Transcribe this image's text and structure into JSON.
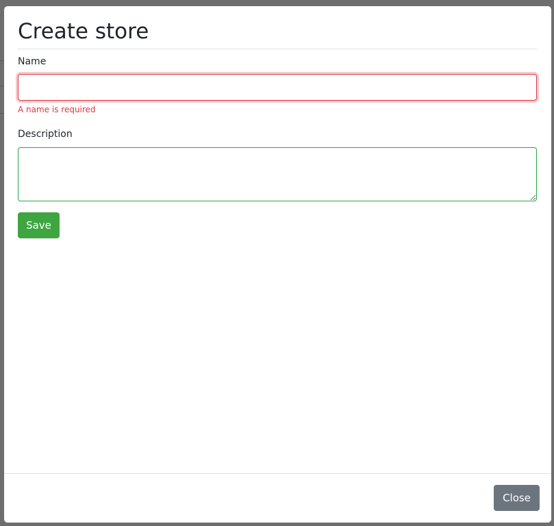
{
  "modal": {
    "title": "Create store"
  },
  "form": {
    "name_label": "Name",
    "name_value": "",
    "name_error": "A name is required",
    "description_label": "Description",
    "description_value": "",
    "save_label": "Save"
  },
  "footer": {
    "close_label": "Close"
  },
  "colors": {
    "error": "#dc3545",
    "valid": "#28a745",
    "save_button": "#3fa541",
    "close_button": "#6c757d"
  }
}
